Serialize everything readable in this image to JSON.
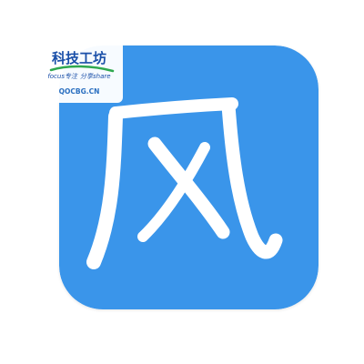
{
  "icon": {
    "glyph": "风",
    "background": "#3a95ea",
    "glyph_color": "#ffffff"
  },
  "watermark": {
    "title": "科技工坊",
    "tagline_left": "focus专注",
    "tagline_right": "分享share",
    "url": "QOCBG.CN",
    "title_color": "#1a4fa8",
    "swoosh_color": "#2fa84f",
    "tagline_color": "#1a4fa8",
    "url_color": "#2a6fc0"
  }
}
